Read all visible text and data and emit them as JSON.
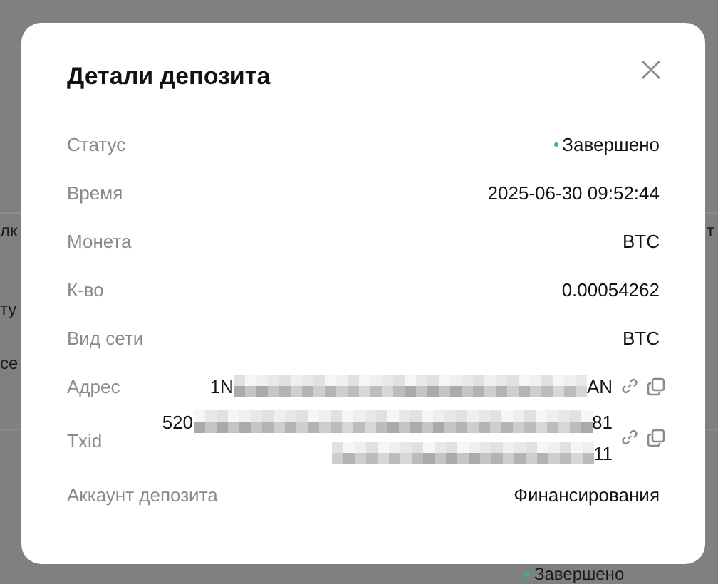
{
  "backdrop": {
    "left_fragments": [
      "лк",
      "ту",
      "ce"
    ],
    "right_fragments": [
      "т"
    ],
    "status": {
      "text": "Завершено",
      "color": "#2ebd85"
    }
  },
  "dialog": {
    "title": "Детали депозита",
    "rows": [
      {
        "kind": "status",
        "label": "Статус",
        "value": "Завершено",
        "color": "#2ebd85"
      },
      {
        "kind": "text",
        "label": "Время",
        "value": "2025-06-30 09:52:44"
      },
      {
        "kind": "text",
        "label": "Монета",
        "value": "BTC"
      },
      {
        "kind": "text",
        "label": "К-во",
        "value": "0.00054262"
      },
      {
        "kind": "text",
        "label": "Вид сети",
        "value": "BTC"
      },
      {
        "kind": "masked",
        "label": "Адрес",
        "lines": [
          {
            "start": "1N",
            "end": "AN"
          }
        ]
      },
      {
        "kind": "masked",
        "label": "Txid",
        "lines": [
          {
            "start": "520",
            "end": "81"
          },
          {
            "end": "11"
          }
        ]
      },
      {
        "kind": "text",
        "label": "Аккаунт депозита",
        "value": "Финансирования"
      }
    ]
  }
}
